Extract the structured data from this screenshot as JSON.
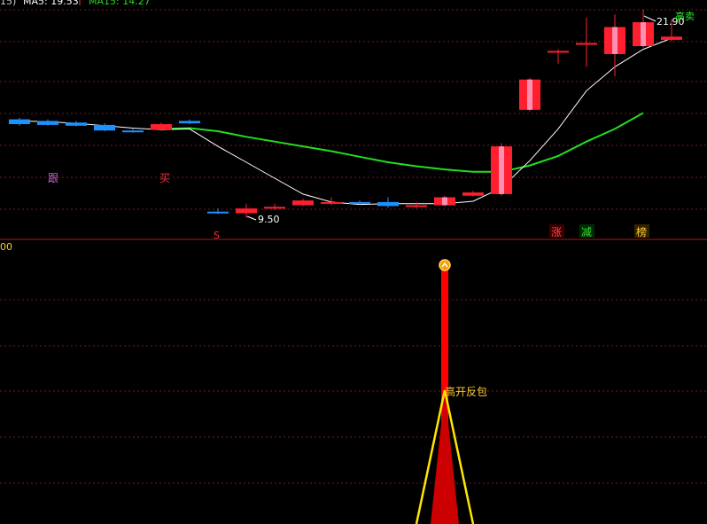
{
  "colors": {
    "background": "#000000",
    "grid": "#7a1a1a",
    "divider": "#b01818",
    "up": "#ff1f2f",
    "down": "#1e90ff",
    "ma5": "#ffffff",
    "ma15": "#22dd22",
    "bar": "#ff0000",
    "triangle": "#ffe600",
    "label_yellow": "#ffcc33"
  },
  "header": {
    "ma5_label": "MA5: 19.53",
    "ma15_label": "MA15: 14.27",
    "partial_left": "15)"
  },
  "indicator_top_value": "00",
  "chart_data": [
    {
      "type": "candlestick",
      "ylim": [
        8.6,
        23.2
      ],
      "candles": [
        {
          "o": 15.7,
          "c": 15.4,
          "h": 15.8,
          "l": 15.3
        },
        {
          "o": 15.6,
          "c": 15.35,
          "h": 15.7,
          "l": 15.3
        },
        {
          "o": 15.5,
          "c": 15.3,
          "h": 15.6,
          "l": 15.25
        },
        {
          "o": 15.35,
          "c": 15.0,
          "h": 15.45,
          "l": 14.95
        },
        {
          "o": 15.0,
          "c": 14.9,
          "h": 15.1,
          "l": 14.85
        },
        {
          "o": 15.05,
          "c": 15.4,
          "h": 15.5,
          "l": 15.0
        },
        {
          "o": 15.6,
          "c": 15.45,
          "h": 15.7,
          "l": 15.4
        },
        {
          "o": 9.9,
          "c": 9.85,
          "h": 10.1,
          "l": 9.75
        },
        {
          "o": 9.8,
          "c": 10.1,
          "h": 10.4,
          "l": 9.5
        },
        {
          "o": 10.1,
          "c": 10.2,
          "h": 10.4,
          "l": 10.0
        },
        {
          "o": 10.3,
          "c": 10.6,
          "h": 10.7,
          "l": 10.25
        },
        {
          "o": 10.4,
          "c": 10.5,
          "h": 10.8,
          "l": 10.3
        },
        {
          "o": 10.5,
          "c": 10.4,
          "h": 10.6,
          "l": 10.35
        },
        {
          "o": 10.5,
          "c": 10.25,
          "h": 10.8,
          "l": 10.15
        },
        {
          "o": 10.25,
          "c": 10.3,
          "h": 10.5,
          "l": 10.1
        },
        {
          "o": 10.3,
          "c": 10.8,
          "h": 10.9,
          "l": 10.25
        },
        {
          "o": 10.9,
          "c": 11.1,
          "h": 11.2,
          "l": 10.85
        },
        {
          "o": 11.0,
          "c": 14.0,
          "h": 14.2,
          "l": 10.9
        },
        {
          "o": 16.3,
          "c": 18.2,
          "h": 18.3,
          "l": 16.2
        },
        {
          "o": 20.0,
          "c": 20.0,
          "h": 20.1,
          "l": 19.2
        },
        {
          "o": 20.4,
          "c": 20.5,
          "h": 22.1,
          "l": 19.0
        },
        {
          "o": 19.8,
          "c": 21.5,
          "h": 22.3,
          "l": 18.4
        },
        {
          "o": 20.3,
          "c": 21.8,
          "h": 22.6,
          "l": 20.2
        },
        {
          "o": 20.7,
          "c": 20.9,
          "h": 22.0,
          "l": 20.6
        }
      ],
      "ma5": [
        15.6,
        15.55,
        15.45,
        15.3,
        15.15,
        15.05,
        15.1,
        14.0,
        13.0,
        12.0,
        11.0,
        10.5,
        10.35,
        10.4,
        10.4,
        10.4,
        10.55,
        11.4,
        13.1,
        15.1,
        17.5,
        19.0,
        20.1,
        20.8
      ],
      "ma15": [
        null,
        null,
        null,
        null,
        null,
        15.1,
        15.15,
        14.95,
        14.6,
        14.3,
        14.0,
        13.7,
        13.35,
        13.0,
        12.75,
        12.55,
        12.4,
        12.4,
        12.8,
        13.4,
        14.3,
        15.1,
        16.1,
        null
      ],
      "annotations": {
        "high": "21.90",
        "low": "9.50",
        "markers": [
          "跟",
          "买",
          "S",
          "涨",
          "减",
          "榜"
        ],
        "corner_signal": "高卖"
      }
    },
    {
      "type": "bar",
      "ylim": [
        0,
        100
      ],
      "signal_index": 15,
      "value": 97,
      "signal_label": "高开反包"
    }
  ]
}
